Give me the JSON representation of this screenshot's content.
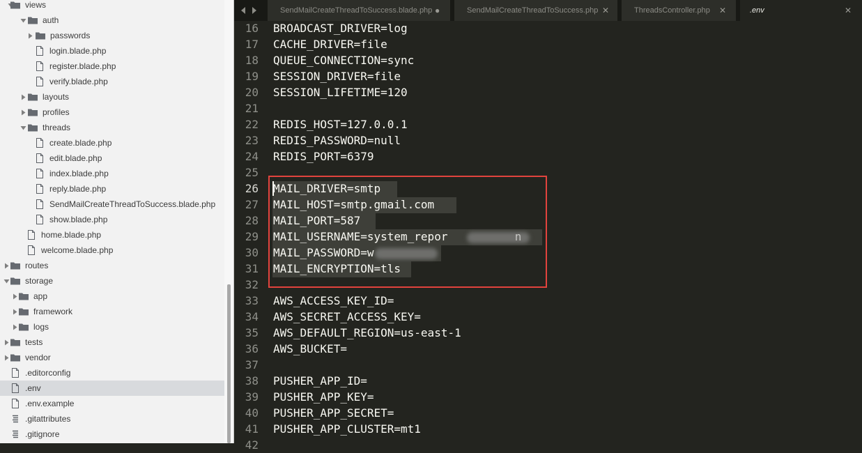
{
  "sidebar": {
    "items": [
      {
        "label": "views",
        "type": "folder",
        "expanded": true
      },
      {
        "label": "auth",
        "type": "folder",
        "expanded": true
      },
      {
        "label": "passwords",
        "type": "folder",
        "expanded": false
      },
      {
        "label": "login.blade.php",
        "type": "file"
      },
      {
        "label": "register.blade.php",
        "type": "file"
      },
      {
        "label": "verify.blade.php",
        "type": "file"
      },
      {
        "label": "layouts",
        "type": "folder",
        "expanded": false
      },
      {
        "label": "profiles",
        "type": "folder",
        "expanded": false
      },
      {
        "label": "threads",
        "type": "folder",
        "expanded": true
      },
      {
        "label": "create.blade.php",
        "type": "file"
      },
      {
        "label": "edit.blade.php",
        "type": "file"
      },
      {
        "label": "index.blade.php",
        "type": "file"
      },
      {
        "label": "reply.blade.php",
        "type": "file"
      },
      {
        "label": "SendMailCreateThreadToSuccess.blade.php",
        "type": "file"
      },
      {
        "label": "show.blade.php",
        "type": "file"
      },
      {
        "label": "home.blade.php",
        "type": "file"
      },
      {
        "label": "welcome.blade.php",
        "type": "file"
      },
      {
        "label": "routes",
        "type": "folder",
        "expanded": false
      },
      {
        "label": "storage",
        "type": "folder",
        "expanded": true
      },
      {
        "label": "app",
        "type": "folder",
        "expanded": false
      },
      {
        "label": "framework",
        "type": "folder",
        "expanded": false
      },
      {
        "label": "logs",
        "type": "folder",
        "expanded": false
      },
      {
        "label": "tests",
        "type": "folder",
        "expanded": false
      },
      {
        "label": "vendor",
        "type": "folder",
        "expanded": false
      },
      {
        "label": ".editorconfig",
        "type": "file"
      },
      {
        "label": ".env",
        "type": "file",
        "selected": true
      },
      {
        "label": ".env.example",
        "type": "file"
      },
      {
        "label": ".gitattributes",
        "type": "file-lines"
      },
      {
        "label": ".gitignore",
        "type": "file-lines"
      }
    ]
  },
  "tabs": [
    {
      "title": "SendMailCreateThreadToSuccess.blade.php",
      "state": "modified",
      "mark": "●"
    },
    {
      "title": "SendMailCreateThreadToSuccess.php",
      "state": "clean",
      "mark": "✕"
    },
    {
      "title": "ThreadsController.php",
      "state": "clean",
      "mark": "✕"
    },
    {
      "title": ".env",
      "state": "active",
      "mark": "✕"
    }
  ],
  "editor": {
    "current_line": 26,
    "lines": [
      {
        "n": "16",
        "text": "BROADCAST_DRIVER=log"
      },
      {
        "n": "17",
        "text": "CACHE_DRIVER=file"
      },
      {
        "n": "18",
        "text": "QUEUE_CONNECTION=sync"
      },
      {
        "n": "19",
        "text": "SESSION_DRIVER=file"
      },
      {
        "n": "20",
        "text": "SESSION_LIFETIME=120"
      },
      {
        "n": "21",
        "text": ""
      },
      {
        "n": "22",
        "text": "REDIS_HOST=127.0.0.1"
      },
      {
        "n": "23",
        "text": "REDIS_PASSWORD=null"
      },
      {
        "n": "24",
        "text": "REDIS_PORT=6379"
      },
      {
        "n": "25",
        "text": ""
      },
      {
        "n": "26",
        "text": "MAIL_DRIVER=smtp"
      },
      {
        "n": "27",
        "text": "MAIL_HOST=smtp.gmail.com"
      },
      {
        "n": "28",
        "text": "MAIL_PORT=587"
      },
      {
        "n": "29",
        "text": "MAIL_USERNAME=system_repor          n"
      },
      {
        "n": "30",
        "text": "MAIL_PASSWORD=w"
      },
      {
        "n": "31",
        "text": "MAIL_ENCRYPTION=tls"
      },
      {
        "n": "32",
        "text": ""
      },
      {
        "n": "33",
        "text": "AWS_ACCESS_KEY_ID="
      },
      {
        "n": "34",
        "text": "AWS_SECRET_ACCESS_KEY="
      },
      {
        "n": "35",
        "text": "AWS_DEFAULT_REGION=us-east-1"
      },
      {
        "n": "36",
        "text": "AWS_BUCKET="
      },
      {
        "n": "37",
        "text": ""
      },
      {
        "n": "38",
        "text": "PUSHER_APP_ID="
      },
      {
        "n": "39",
        "text": "PUSHER_APP_KEY="
      },
      {
        "n": "40",
        "text": "PUSHER_APP_SECRET="
      },
      {
        "n": "41",
        "text": "PUSHER_APP_CLUSTER=mt1"
      },
      {
        "n": "42",
        "text": ""
      }
    ]
  },
  "colors": {
    "highlight_border": "#e2433d",
    "editor_bg": "#23241f",
    "sidebar_bg": "#f2f2f2"
  }
}
